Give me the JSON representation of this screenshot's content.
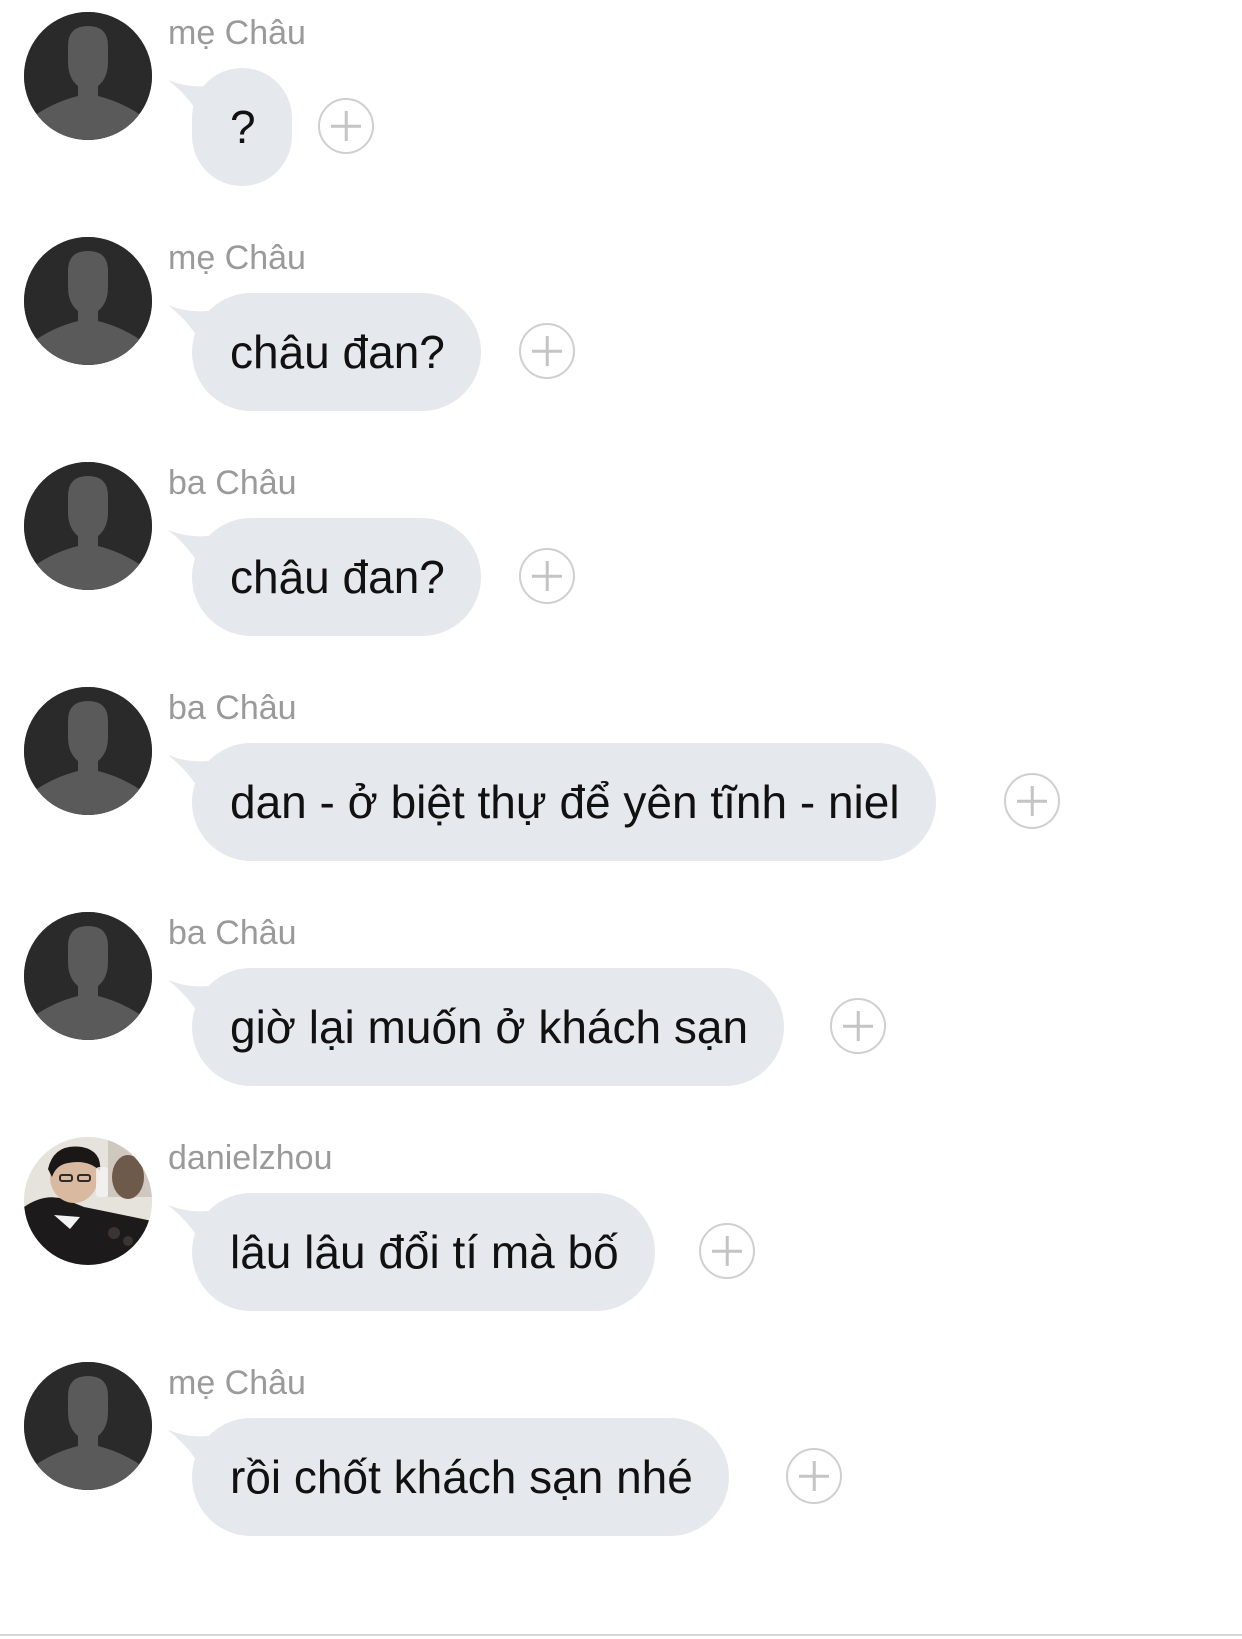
{
  "messages": [
    {
      "sender": "mẹ Châu",
      "text": "?",
      "avatar": "default-silhouette-icon"
    },
    {
      "sender": "mẹ Châu",
      "text": "châu đan?",
      "avatar": "default-silhouette-icon"
    },
    {
      "sender": "ba Châu",
      "text": "châu đan?",
      "avatar": "default-silhouette-icon"
    },
    {
      "sender": "ba Châu",
      "text": "dan - ở biệt thự để yên tĩnh - niel",
      "avatar": "default-silhouette-icon"
    },
    {
      "sender": "ba Châu",
      "text": "giờ lại muốn ở khách sạn",
      "avatar": "default-silhouette-icon"
    },
    {
      "sender": "danielzhou",
      "text": "lâu lâu đổi tí mà bố",
      "avatar": "profile-photo"
    },
    {
      "sender": "mẹ Châu",
      "text": "rồi chốt khách sạn nhé",
      "avatar": "default-silhouette-icon"
    }
  ],
  "colors": {
    "bubble": "#e5e8ec",
    "sender_text": "#9a9a9a",
    "message_text": "#111111",
    "avatar_bg": "#2a2a2a",
    "silhouette": "#5a5a5a",
    "react_icon": "#cfcfcf"
  },
  "icons": {
    "reaction": "plus-circle-icon"
  }
}
